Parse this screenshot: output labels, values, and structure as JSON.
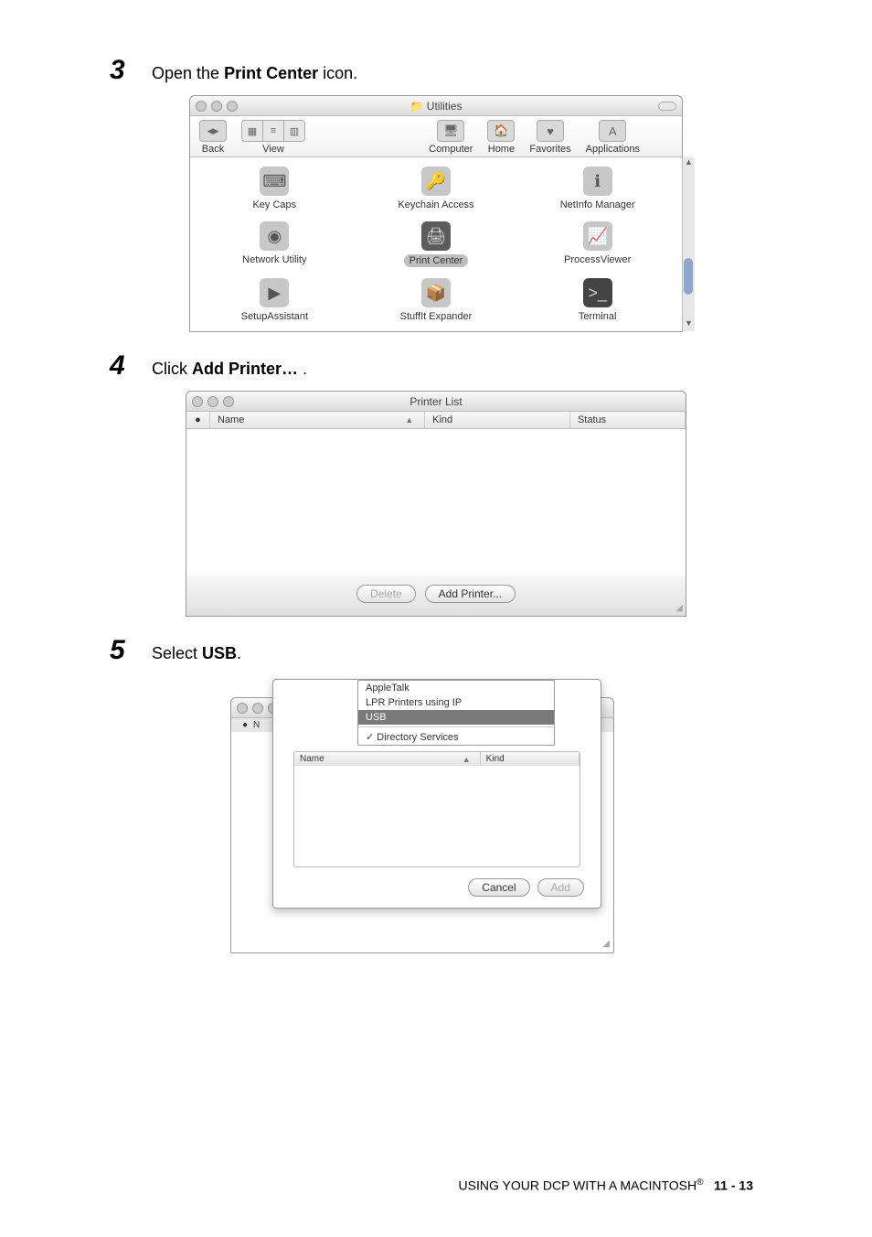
{
  "steps": {
    "s3": {
      "num": "3",
      "text_a": "Open the ",
      "bold": "Print Center",
      "text_b": " icon."
    },
    "s4": {
      "num": "4",
      "text_a": "Click ",
      "bold": "Add Printer…",
      "text_b": " ."
    },
    "s5": {
      "num": "5",
      "text_a": "Select ",
      "bold": "USB",
      "text_b": "."
    }
  },
  "win1": {
    "title": "Utilities",
    "toolbar": {
      "back": "Back",
      "view": "View",
      "computer": "Computer",
      "home": "Home",
      "favorites": "Favorites",
      "applications": "Applications"
    },
    "apps": {
      "keycaps": "Key Caps",
      "keychain": "Keychain Access",
      "netinfo": "NetInfo Manager",
      "netutil": "Network Utility",
      "printcenter": "Print Center",
      "procview": "ProcessViewer",
      "setup": "SetupAssistant",
      "stuffit": "StuffIt Expander",
      "terminal": "Terminal"
    }
  },
  "win2": {
    "title": "Printer List",
    "columns": {
      "name": "Name",
      "kind": "Kind",
      "status": "Status"
    },
    "buttons": {
      "delete": "Delete",
      "add": "Add Printer..."
    }
  },
  "win3": {
    "menu": {
      "appletalk": "AppleTalk",
      "lpr": "LPR Printers using IP",
      "usb": "USB",
      "dir": "Directory Services"
    },
    "cols": {
      "name": "Name",
      "kind": "Kind"
    },
    "buttons": {
      "cancel": "Cancel",
      "add": "Add"
    },
    "back_col": "N"
  },
  "footer": {
    "text": "USING YOUR DCP WITH A MACINTOSH",
    "reg": "®",
    "page": "11 - 13"
  }
}
